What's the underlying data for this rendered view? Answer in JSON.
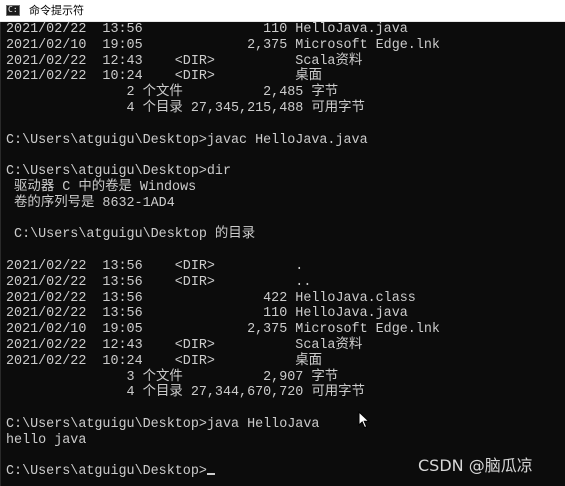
{
  "window": {
    "title": "命令提示符",
    "icon": "console-icon"
  },
  "console": {
    "lines": [
      "2021/02/22  13:56               110 HelloJava.java",
      "2021/02/10  19:05             2,375 Microsoft Edge.lnk",
      "2021/02/22  12:43    <DIR>          Scala资料",
      "2021/02/22  10:24    <DIR>          桌面",
      "               2 个文件          2,485 字节",
      "               4 个目录 27,345,215,488 可用字节",
      "",
      "C:\\Users\\atguigu\\Desktop>javac HelloJava.java",
      "",
      "C:\\Users\\atguigu\\Desktop>dir",
      " 驱动器 C 中的卷是 Windows",
      " 卷的序列号是 8632-1AD4",
      "",
      " C:\\Users\\atguigu\\Desktop 的目录",
      "",
      "2021/02/22  13:56    <DIR>          .",
      "2021/02/22  13:56    <DIR>          ..",
      "2021/02/22  13:56               422 HelloJava.class",
      "2021/02/22  13:56               110 HelloJava.java",
      "2021/02/10  19:05             2,375 Microsoft Edge.lnk",
      "2021/02/22  12:43    <DIR>          Scala资料",
      "2021/02/22  10:24    <DIR>          桌面",
      "               3 个文件          2,907 字节",
      "               4 个目录 27,344,670,720 可用字节",
      "",
      "C:\\Users\\atguigu\\Desktop>java HelloJava",
      "hello java",
      "",
      "C:\\Users\\atguigu\\Desktop>"
    ]
  },
  "watermark": "CSDN @脑瓜凉",
  "colors": {
    "console_bg": "#0c0c0c",
    "console_fg": "#cccccc",
    "titlebar_bg": "#ffffff"
  }
}
